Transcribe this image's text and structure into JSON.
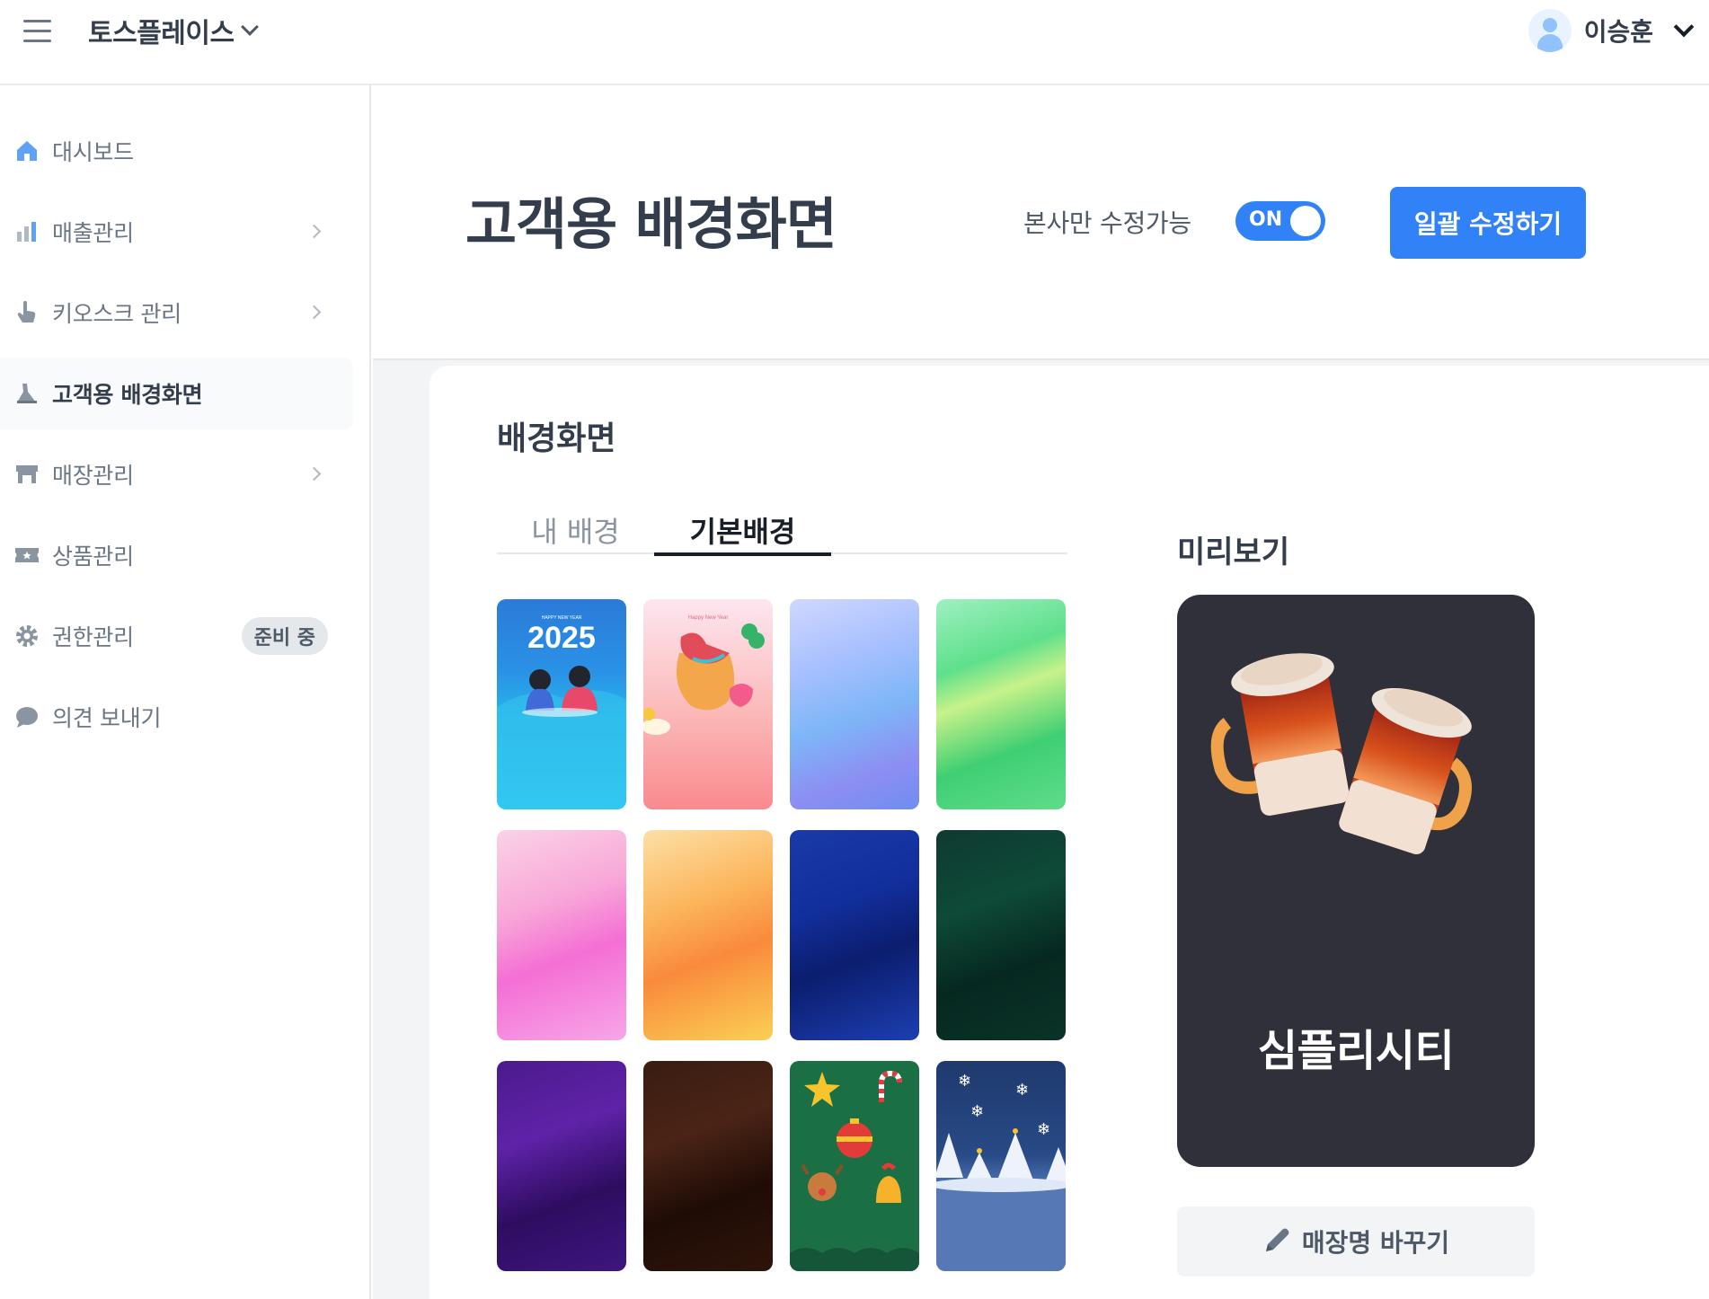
{
  "topbar": {
    "brand_name": "토스플레이스",
    "user_name": "이승훈"
  },
  "sidebar": {
    "items": [
      {
        "label": "대시보드",
        "icon": "home-icon"
      },
      {
        "label": "매출관리",
        "icon": "bar-chart-icon"
      },
      {
        "label": "키오스크 관리",
        "icon": "hand-pointer-icon"
      },
      {
        "label": "고객용 배경화면",
        "icon": "brush-icon",
        "active": true
      },
      {
        "label": "매장관리",
        "icon": "store-icon"
      },
      {
        "label": "상품관리",
        "icon": "ticket-icon"
      },
      {
        "label": "권한관리",
        "icon": "gear-icon",
        "badge": "준비 중"
      },
      {
        "label": "의견 보내기",
        "icon": "chat-bubble-icon"
      }
    ]
  },
  "header": {
    "title": "고객용 배경화면",
    "permission_label": "본사만 수정가능",
    "toggle_text": "ON",
    "toggle_on": true,
    "bulk_edit_button": "일괄 수정하기"
  },
  "background": {
    "section_title": "배경화면",
    "tabs": [
      {
        "label": "내 배경",
        "selected": false
      },
      {
        "label": "기본배경",
        "selected": true
      }
    ],
    "thumbnails": [
      {
        "name": "new-year-2025",
        "text": "2025",
        "caption": "HAPPY NEW YEAR"
      },
      {
        "name": "lucky-bag",
        "caption": "Happy New Year"
      },
      {
        "name": "gradient-blue-purple"
      },
      {
        "name": "gradient-green"
      },
      {
        "name": "gradient-pink"
      },
      {
        "name": "gradient-orange"
      },
      {
        "name": "gradient-navy"
      },
      {
        "name": "gradient-dark-green"
      },
      {
        "name": "gradient-purple"
      },
      {
        "name": "gradient-brown"
      },
      {
        "name": "christmas-ornaments"
      },
      {
        "name": "snowy-trees"
      }
    ]
  },
  "preview": {
    "label": "미리보기",
    "store_name": "심플리시티",
    "rename_button": "매장명 바꾸기"
  },
  "colors": {
    "accent": "#3182f6",
    "preview_bg": "#2f3039"
  }
}
